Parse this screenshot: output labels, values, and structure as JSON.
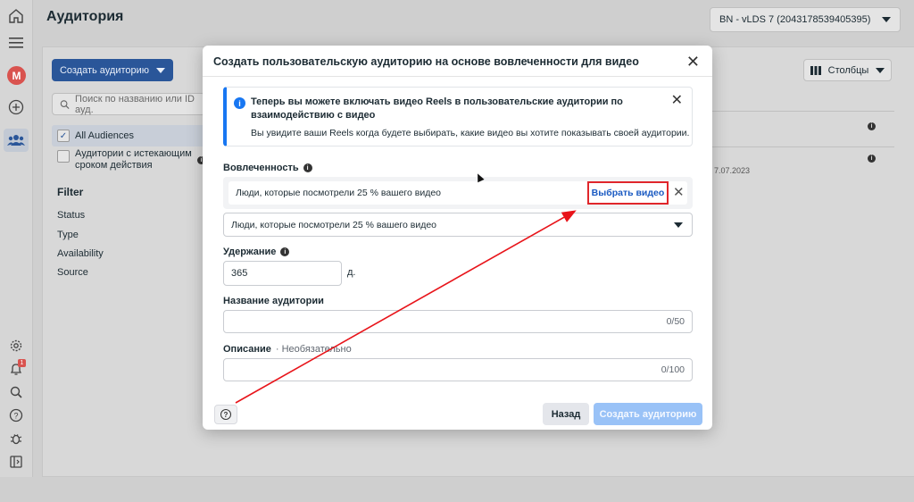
{
  "app": {
    "page_title": "Аудитория",
    "account_selector": "BN - vLDS 7 (2043178539405395)",
    "avatar_letter": "M",
    "notifications_count": "1"
  },
  "toolbar": {
    "create_audience_label": "Создать аудиторию",
    "search_placeholder": "Поиск по названию или ID ауд.",
    "columns_label": "Столбцы"
  },
  "sidebar": {
    "all_audiences": "All Audiences",
    "expiring_audiences": "Аудитории с истекающим сроком действия",
    "filter_heading": "Filter",
    "filters": [
      "Status",
      "Type",
      "Availability",
      "Source"
    ]
  },
  "background_table": {
    "partial_date": "7.07.2023"
  },
  "modal": {
    "title": "Создать пользовательскую аудиторию на основе вовлеченности для видео",
    "notice": {
      "title": "Теперь вы можете включать видео Reels в пользовательские аудитории по взаимодействию с видео",
      "text": "Вы увидите ваши Reels когда будете выбирать, какие видео вы хотите показывать своей аудитории."
    },
    "engagement_label": "Вовлеченность",
    "video_row_text": "Люди, которые посмотрели 25 % вашего видео",
    "choose_video_label": "Выбрать видео",
    "engagement_dropdown_value": "Люди, которые посмотрели 25 % вашего видео",
    "retention_label": "Удержание",
    "retention_value": "365",
    "retention_unit": "д.",
    "audience_name_label": "Название аудитории",
    "audience_name_counter": "0/50",
    "description_label": "Описание",
    "description_optional": "· Необязательно",
    "description_counter": "0/100",
    "back_label": "Назад",
    "create_label": "Создать аудиторию"
  },
  "colors": {
    "accent": "#1877f2",
    "highlight_box": "#e0262b",
    "annotation_arrow": "#e8141a"
  }
}
